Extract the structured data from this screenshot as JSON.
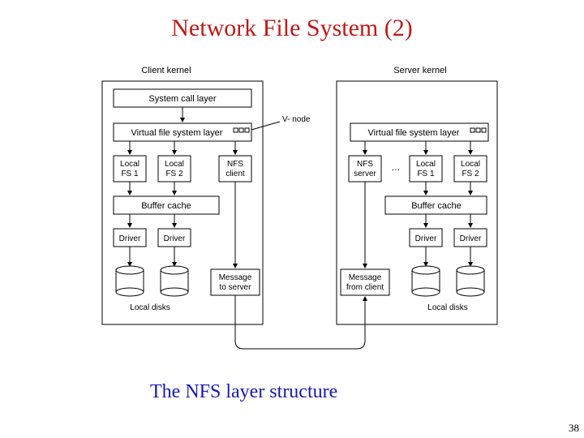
{
  "title": "Network File System (2)",
  "caption": "The NFS layer structure",
  "page_number": "38",
  "client": {
    "heading": "Client kernel",
    "syscall": "System call layer",
    "vfs": "Virtual file system layer",
    "vnode_label": "V- node",
    "fs1": "Local\nFS 1",
    "fs2": "Local\nFS 2",
    "nfs_client": "NFS\nclient",
    "buffer": "Buffer cache",
    "driver1": "Driver",
    "driver2": "Driver",
    "msg": "Message\nto server",
    "disks": "Local disks"
  },
  "server": {
    "heading": "Server kernel",
    "vfs": "Virtual file system layer",
    "nfs_server": "NFS\nserver",
    "fs1": "Local\nFS 1",
    "fs2": "Local\nFS 2",
    "buffer": "Buffer cache",
    "driver1": "Driver",
    "driver2": "Driver",
    "msg": "Message\nfrom client",
    "disks": "Local disks"
  }
}
